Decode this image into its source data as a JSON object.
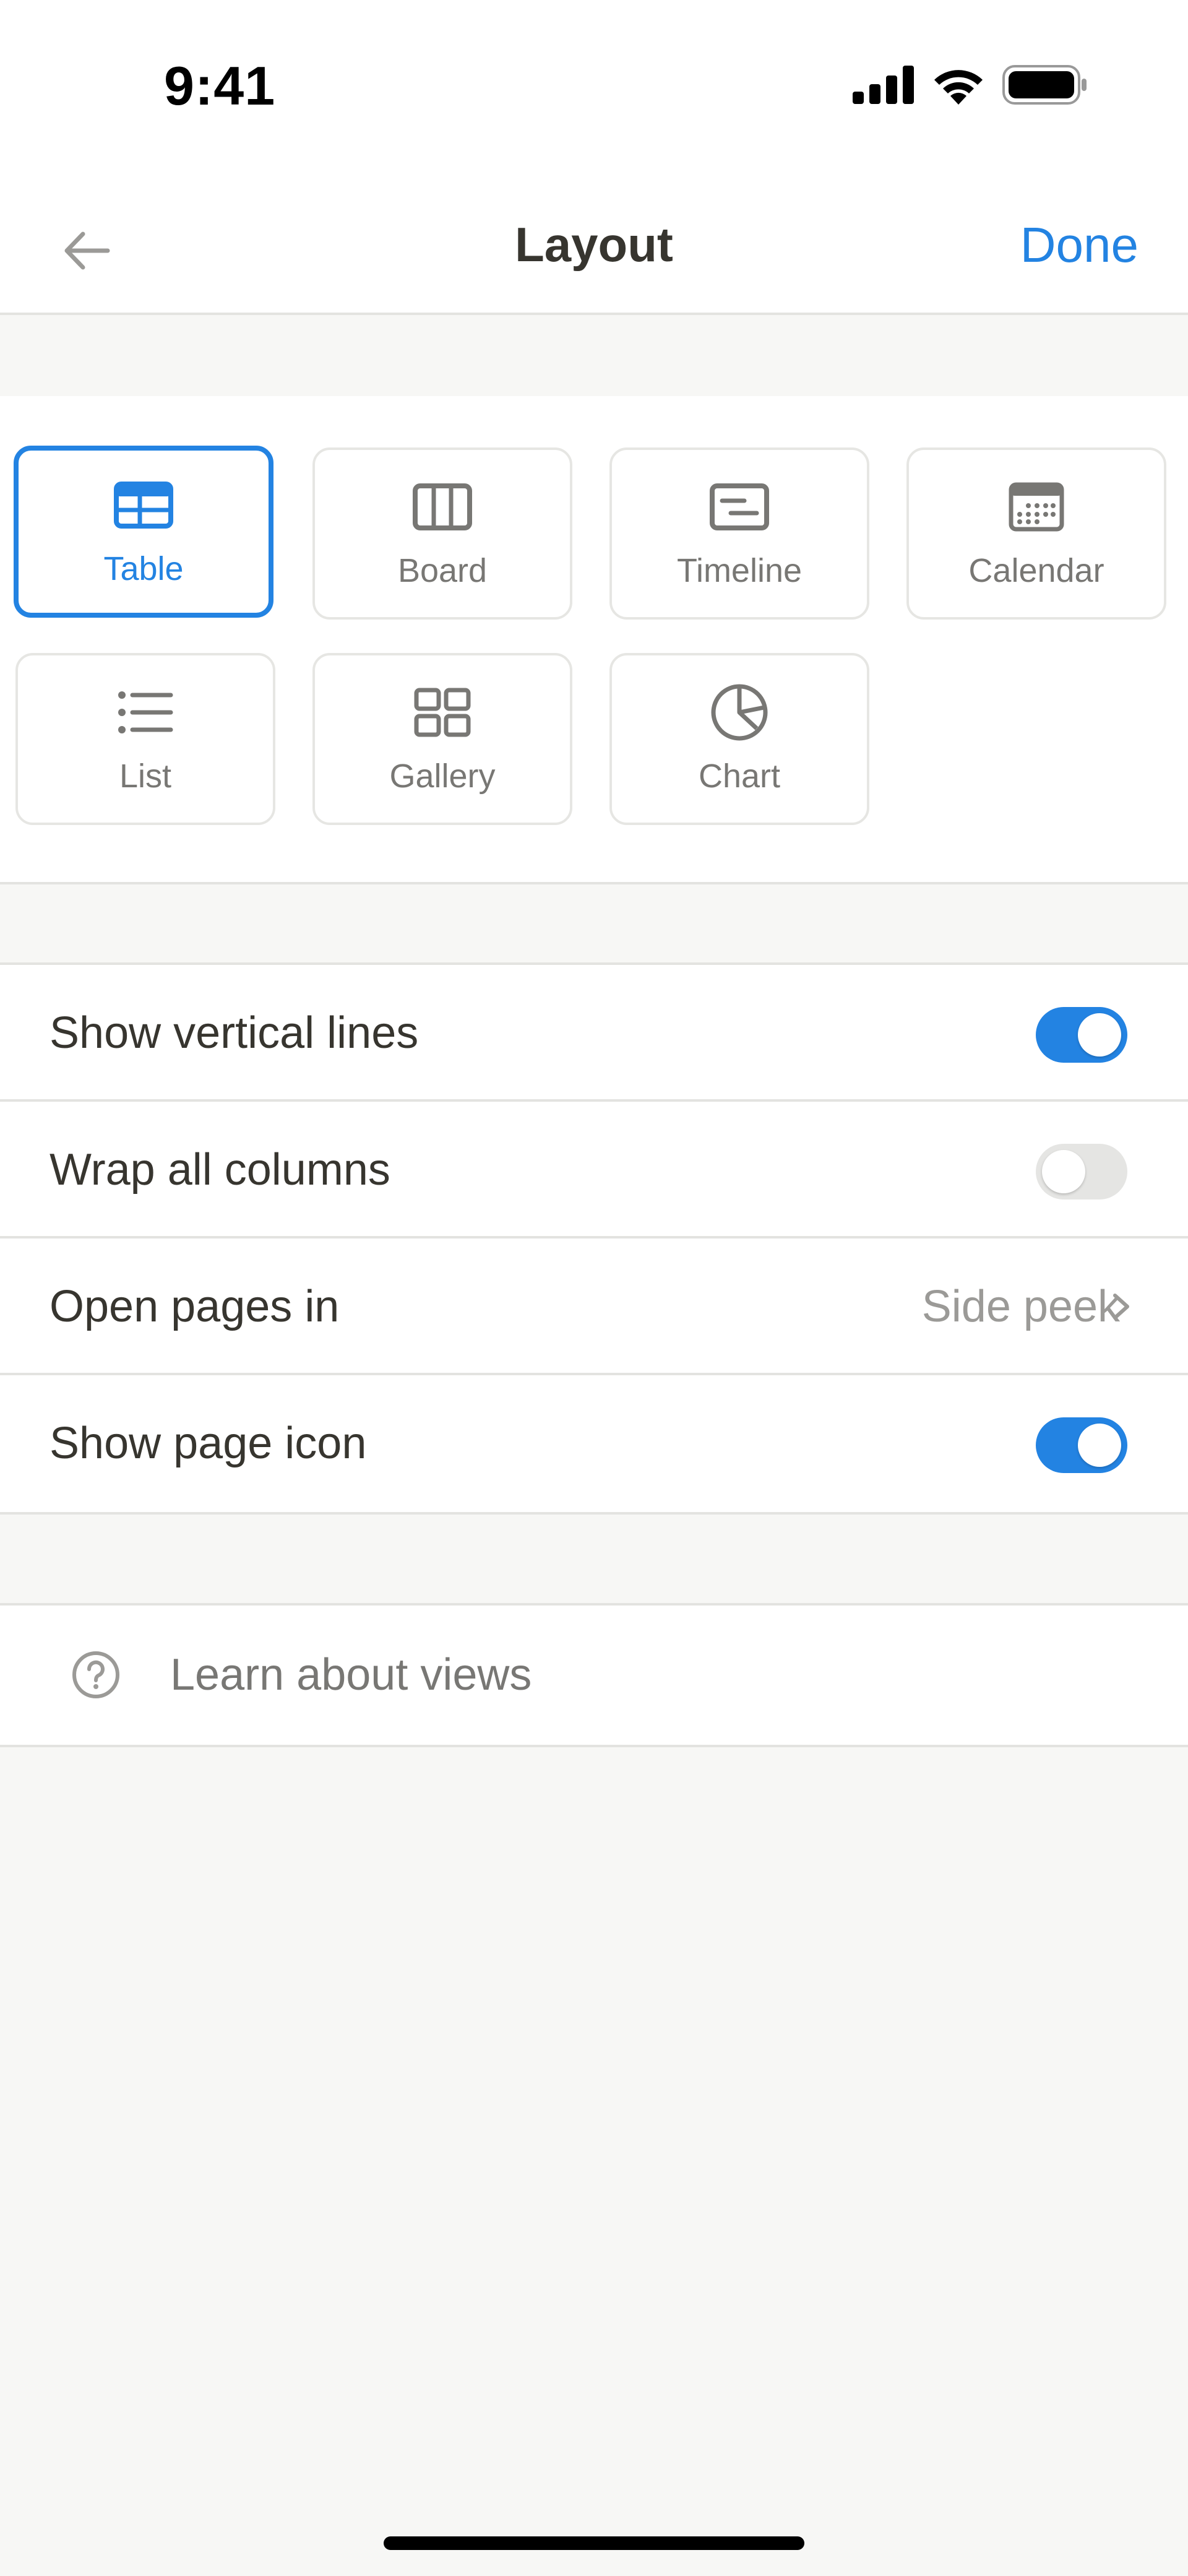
{
  "status_bar": {
    "time": "9:41"
  },
  "navbar": {
    "title": "Layout",
    "done_label": "Done"
  },
  "layouts": [
    {
      "label": "Table",
      "icon": "table-icon",
      "selected": true
    },
    {
      "label": "Board",
      "icon": "board-icon",
      "selected": false
    },
    {
      "label": "Timeline",
      "icon": "timeline-icon",
      "selected": false
    },
    {
      "label": "Calendar",
      "icon": "calendar-icon",
      "selected": false
    },
    {
      "label": "List",
      "icon": "list-icon",
      "selected": false
    },
    {
      "label": "Gallery",
      "icon": "gallery-icon",
      "selected": false
    },
    {
      "label": "Chart",
      "icon": "chart-icon",
      "selected": false
    }
  ],
  "settings": {
    "vertical_lines": {
      "label": "Show vertical lines",
      "on": true
    },
    "wrap_columns": {
      "label": "Wrap all columns",
      "on": false
    },
    "open_pages": {
      "label": "Open pages in",
      "value": "Side peek"
    },
    "page_icon": {
      "label": "Show page icon",
      "on": true
    }
  },
  "learn": {
    "label": "Learn about views"
  },
  "colors": {
    "accent": "#2383e2",
    "text": "#37352f",
    "muted": "#787774",
    "background": "#f7f7f5"
  }
}
